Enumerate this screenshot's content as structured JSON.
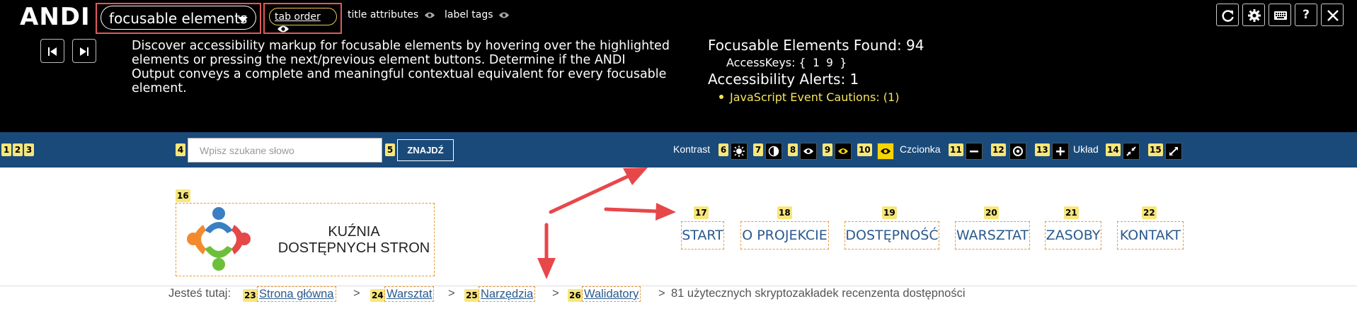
{
  "andi": {
    "logo": "ANDI",
    "module": "focusable elements",
    "tab_order": "tab order",
    "title_attributes": "title attributes",
    "label_tags": "label tags",
    "description": "Discover accessibility markup for focusable elements by hovering over the highlighted elements or pressing the next/previous element buttons. Determine if the ANDI Output conveys a complete and meaningful contextual equivalent for every focusable element.",
    "found": "Focusable Elements Found: 94",
    "access_keys_label": "AccessKeys:",
    "access_keys_value": "{ 1 9 }",
    "alerts": "Accessibility Alerts: 1",
    "caution": "JavaScript Event Cautions: (1)",
    "help": "?"
  },
  "topbar": {
    "search_placeholder": "Wpisz szukane słowo",
    "find_label": "ZNAJDŹ",
    "contrast": "Kontrast",
    "font": "Czcionka",
    "layout": "Układ"
  },
  "badges": [
    "1",
    "2",
    "3",
    "4",
    "5",
    "6",
    "7",
    "8",
    "9",
    "10",
    "11",
    "12",
    "13",
    "14",
    "15",
    "16",
    "17",
    "18",
    "19",
    "20",
    "21",
    "22",
    "23",
    "24",
    "25",
    "26"
  ],
  "logo": {
    "line1": "KUŹNIA",
    "line2": "DOSTĘPNYCH STRON"
  },
  "menu": [
    "START",
    "O PROJEKCIE",
    "DOSTĘPNOŚĆ",
    "WARSZTAT",
    "ZASOBY",
    "KONTAKT"
  ],
  "breadcrumb": {
    "prefix": "Jesteś tutaj:",
    "items": [
      "Strona główna",
      "Warsztat",
      "Narzędzia",
      "Walidatory"
    ],
    "sep": ">",
    "current": "81 użytecznych skryptozakładek recenzenta dostępności"
  },
  "colors": {
    "andi_bg": "#000000",
    "topbar_bg": "#1a4a7a",
    "badge_bg": "#f7e67a",
    "focus_outline": "#e59a3a",
    "highlight_box": "#e05a5a",
    "caution": "#f7e45a",
    "link": "#2a5a8e"
  }
}
